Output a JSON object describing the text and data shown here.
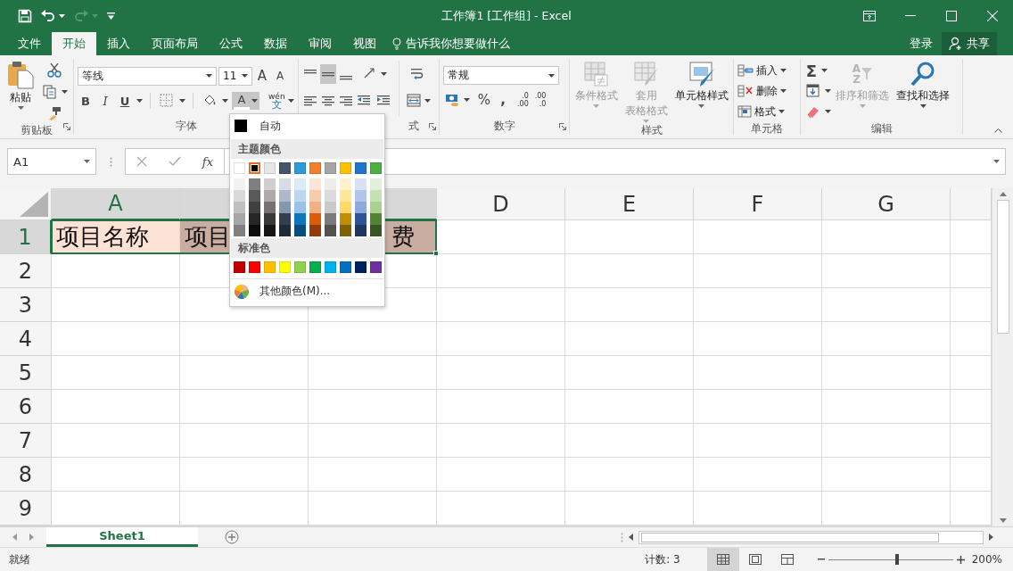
{
  "window": {
    "title": "工作簿1  [工作组] - Excel"
  },
  "quick_access": [
    {
      "kind": "save",
      "disabled": false
    },
    {
      "kind": "undo",
      "disabled": false
    },
    {
      "kind": "redo",
      "disabled": true
    },
    {
      "kind": "customize",
      "disabled": false
    }
  ],
  "ribbon_tabs": [
    {
      "label": "文件",
      "selected": false
    },
    {
      "label": "开始",
      "selected": true
    },
    {
      "label": "插入",
      "selected": false
    },
    {
      "label": "页面布局",
      "selected": false
    },
    {
      "label": "公式",
      "selected": false
    },
    {
      "label": "数据",
      "selected": false
    },
    {
      "label": "审阅",
      "selected": false
    },
    {
      "label": "视图",
      "selected": false
    }
  ],
  "tell_me": {
    "placeholder": "告诉我你想要做什么"
  },
  "sign_in": "登录",
  "share_button": "共享",
  "clipboard": {
    "label": "剪贴板",
    "paste": "粘贴"
  },
  "font": {
    "label": "字体",
    "font_name": "等线",
    "font_size": "11",
    "grow": "A",
    "shrink": "A",
    "bold": "B",
    "italic": "I",
    "underline": "U",
    "font_color": "A",
    "font_color_open": true,
    "phonetic": [
      "wén",
      "文"
    ]
  },
  "alignment": {
    "label": "式",
    "middle_align_pressed": true
  },
  "number": {
    "label": "数字",
    "format": "常规",
    "percent": "%",
    "comma": ",",
    "increase_decimal": [
      ".0",
      ".00"
    ],
    "decrease_decimal": [
      ".00",
      ".0"
    ]
  },
  "styles": {
    "label": "样式",
    "buttons": [
      {
        "kind": "conditional",
        "lines": [
          "条件格式"
        ],
        "disabled": true
      },
      {
        "kind": "table",
        "lines": [
          "套用",
          "表格格式"
        ],
        "disabled": true
      },
      {
        "kind": "cell",
        "lines": [
          "单元格样式"
        ],
        "disabled": false
      }
    ]
  },
  "cells": {
    "label": "单元格",
    "buttons": [
      {
        "kind": "insert",
        "label": "插入"
      },
      {
        "kind": "delete",
        "label": "删除"
      },
      {
        "kind": "format",
        "label": "格式"
      }
    ]
  },
  "editing": {
    "label": "编辑",
    "sum": "Σ",
    "sort": {
      "label": "排序和筛选",
      "icon": [
        "A",
        "Z"
      ],
      "disabled": true
    },
    "find": {
      "label": "查找和选择",
      "disabled": false
    }
  },
  "formula_bar": {
    "name_box": "A1",
    "fx": "fx"
  },
  "grid": {
    "columns": [
      {
        "label": "A",
        "selected": true
      },
      {
        "selected": true
      },
      {
        "selected": true
      },
      {
        "label": "D",
        "selected": false
      },
      {
        "label": "E",
        "selected": false
      },
      {
        "label": "F",
        "selected": false
      },
      {
        "label": "G",
        "selected": false
      },
      {
        "selected": false
      }
    ],
    "rows": [
      {
        "label": "1",
        "selected": true,
        "cells": [
          {
            "text": "项目名称",
            "color": "#fbe2d5"
          },
          {
            "text": "项目",
            "color": "#c9ada1"
          },
          {
            "text": "费",
            "color": "#c9ada1"
          }
        ]
      },
      {
        "label": "2",
        "selected": false
      },
      {
        "label": "3",
        "selected": false
      },
      {
        "label": "4",
        "selected": false
      },
      {
        "label": "5",
        "selected": false
      },
      {
        "label": "6",
        "selected": false
      },
      {
        "label": "7",
        "selected": false
      },
      {
        "label": "8",
        "selected": false
      },
      {
        "label": "9",
        "selected": false
      }
    ]
  },
  "color_menu": {
    "automatic": {
      "label": "自动",
      "color": "#000000"
    },
    "theme_heading": "主题颜色",
    "theme": [
      {
        "color": "#ffffff",
        "selected": false,
        "shades": [
          {
            "color": "#f2f2f2",
            "selected": false
          },
          {
            "color": "#d9d9d9",
            "selected": false
          },
          {
            "color": "#bfbfbf",
            "selected": false
          },
          {
            "color": "#a6a6a6",
            "selected": false
          },
          {
            "color": "#808080",
            "selected": false
          }
        ]
      },
      {
        "color": "#000000",
        "selected": true,
        "shades": [
          {
            "color": "#7f7f7f",
            "selected": false
          },
          {
            "color": "#595959",
            "selected": false
          },
          {
            "color": "#404040",
            "selected": false
          },
          {
            "color": "#262626",
            "selected": false
          },
          {
            "color": "#0d0d0d",
            "selected": false
          }
        ]
      },
      {
        "color": "#e7e6e6",
        "selected": false,
        "shades": [
          {
            "color": "#d0cece",
            "selected": false
          },
          {
            "color": "#aeaaaa",
            "selected": false
          },
          {
            "color": "#757171",
            "selected": false
          },
          {
            "color": "#3a3838",
            "selected": false
          },
          {
            "color": "#171616",
            "selected": false
          }
        ]
      },
      {
        "color": "#44546a",
        "selected": false,
        "shades": [
          {
            "color": "#d6dce4",
            "selected": false
          },
          {
            "color": "#adb9ca",
            "selected": false
          },
          {
            "color": "#8497b0",
            "selected": false
          },
          {
            "color": "#333f4f",
            "selected": false
          },
          {
            "color": "#222b35",
            "selected": false
          }
        ]
      },
      {
        "color": "#2e9ad6",
        "selected": false,
        "shades": [
          {
            "color": "#ddebf7",
            "selected": false
          },
          {
            "color": "#bdd7ee",
            "selected": false
          },
          {
            "color": "#9bc2e6",
            "selected": false
          },
          {
            "color": "#0f75bd",
            "selected": false
          },
          {
            "color": "#0a4e7d",
            "selected": false
          }
        ]
      },
      {
        "color": "#f47e2c",
        "selected": false,
        "shades": [
          {
            "color": "#fce4d6",
            "selected": false
          },
          {
            "color": "#f8cbad",
            "selected": false
          },
          {
            "color": "#f4b084",
            "selected": false
          },
          {
            "color": "#dc5a0a",
            "selected": false
          },
          {
            "color": "#933c0c",
            "selected": false
          }
        ]
      },
      {
        "color": "#a5a5a5",
        "selected": false,
        "shades": [
          {
            "color": "#ededed",
            "selected": false
          },
          {
            "color": "#dbdbdb",
            "selected": false
          },
          {
            "color": "#c9c9c9",
            "selected": false
          },
          {
            "color": "#7b7b7b",
            "selected": false
          },
          {
            "color": "#525252",
            "selected": false
          }
        ]
      },
      {
        "color": "#ffc000",
        "selected": false,
        "shades": [
          {
            "color": "#fff2cc",
            "selected": false
          },
          {
            "color": "#ffe699",
            "selected": false
          },
          {
            "color": "#ffd966",
            "selected": false
          },
          {
            "color": "#bf8f00",
            "selected": false
          },
          {
            "color": "#806000",
            "selected": false
          }
        ]
      },
      {
        "color": "#1f73c8",
        "selected": false,
        "shades": [
          {
            "color": "#d9e1f2",
            "selected": false
          },
          {
            "color": "#b4c6e7",
            "selected": false
          },
          {
            "color": "#8eaadb",
            "selected": false
          },
          {
            "color": "#2f5496",
            "selected": false
          },
          {
            "color": "#203764",
            "selected": false
          }
        ]
      },
      {
        "color": "#4caf44",
        "selected": false,
        "shades": [
          {
            "color": "#e2efda",
            "selected": false
          },
          {
            "color": "#c6e0b4",
            "selected": false
          },
          {
            "color": "#a9d08e",
            "selected": false
          },
          {
            "color": "#548235",
            "selected": false
          },
          {
            "color": "#375623",
            "selected": false
          }
        ]
      }
    ],
    "standard_heading": "标准色",
    "standard": [
      {
        "color": "#c00000",
        "selected": false
      },
      {
        "color": "#ff0000",
        "selected": false
      },
      {
        "color": "#ffc000",
        "selected": false
      },
      {
        "color": "#ffff00",
        "selected": false
      },
      {
        "color": "#92d050",
        "selected": false
      },
      {
        "color": "#00b050",
        "selected": false
      },
      {
        "color": "#00b0f0",
        "selected": false
      },
      {
        "color": "#0070c0",
        "selected": false
      },
      {
        "color": "#002060",
        "selected": false
      },
      {
        "color": "#7030a0",
        "selected": false
      }
    ],
    "more": "其他颜色(M)..."
  },
  "sheet_tabs": [
    {
      "label": "Sheet1",
      "selected": true
    }
  ],
  "status_bar": {
    "status": "就绪",
    "count": "计数: 3",
    "views": [
      {
        "kind": "normal",
        "selected": true
      },
      {
        "kind": "page_layout",
        "selected": false
      },
      {
        "kind": "page_break",
        "selected": false
      }
    ],
    "zoom": "200%",
    "level": 0.55
  }
}
